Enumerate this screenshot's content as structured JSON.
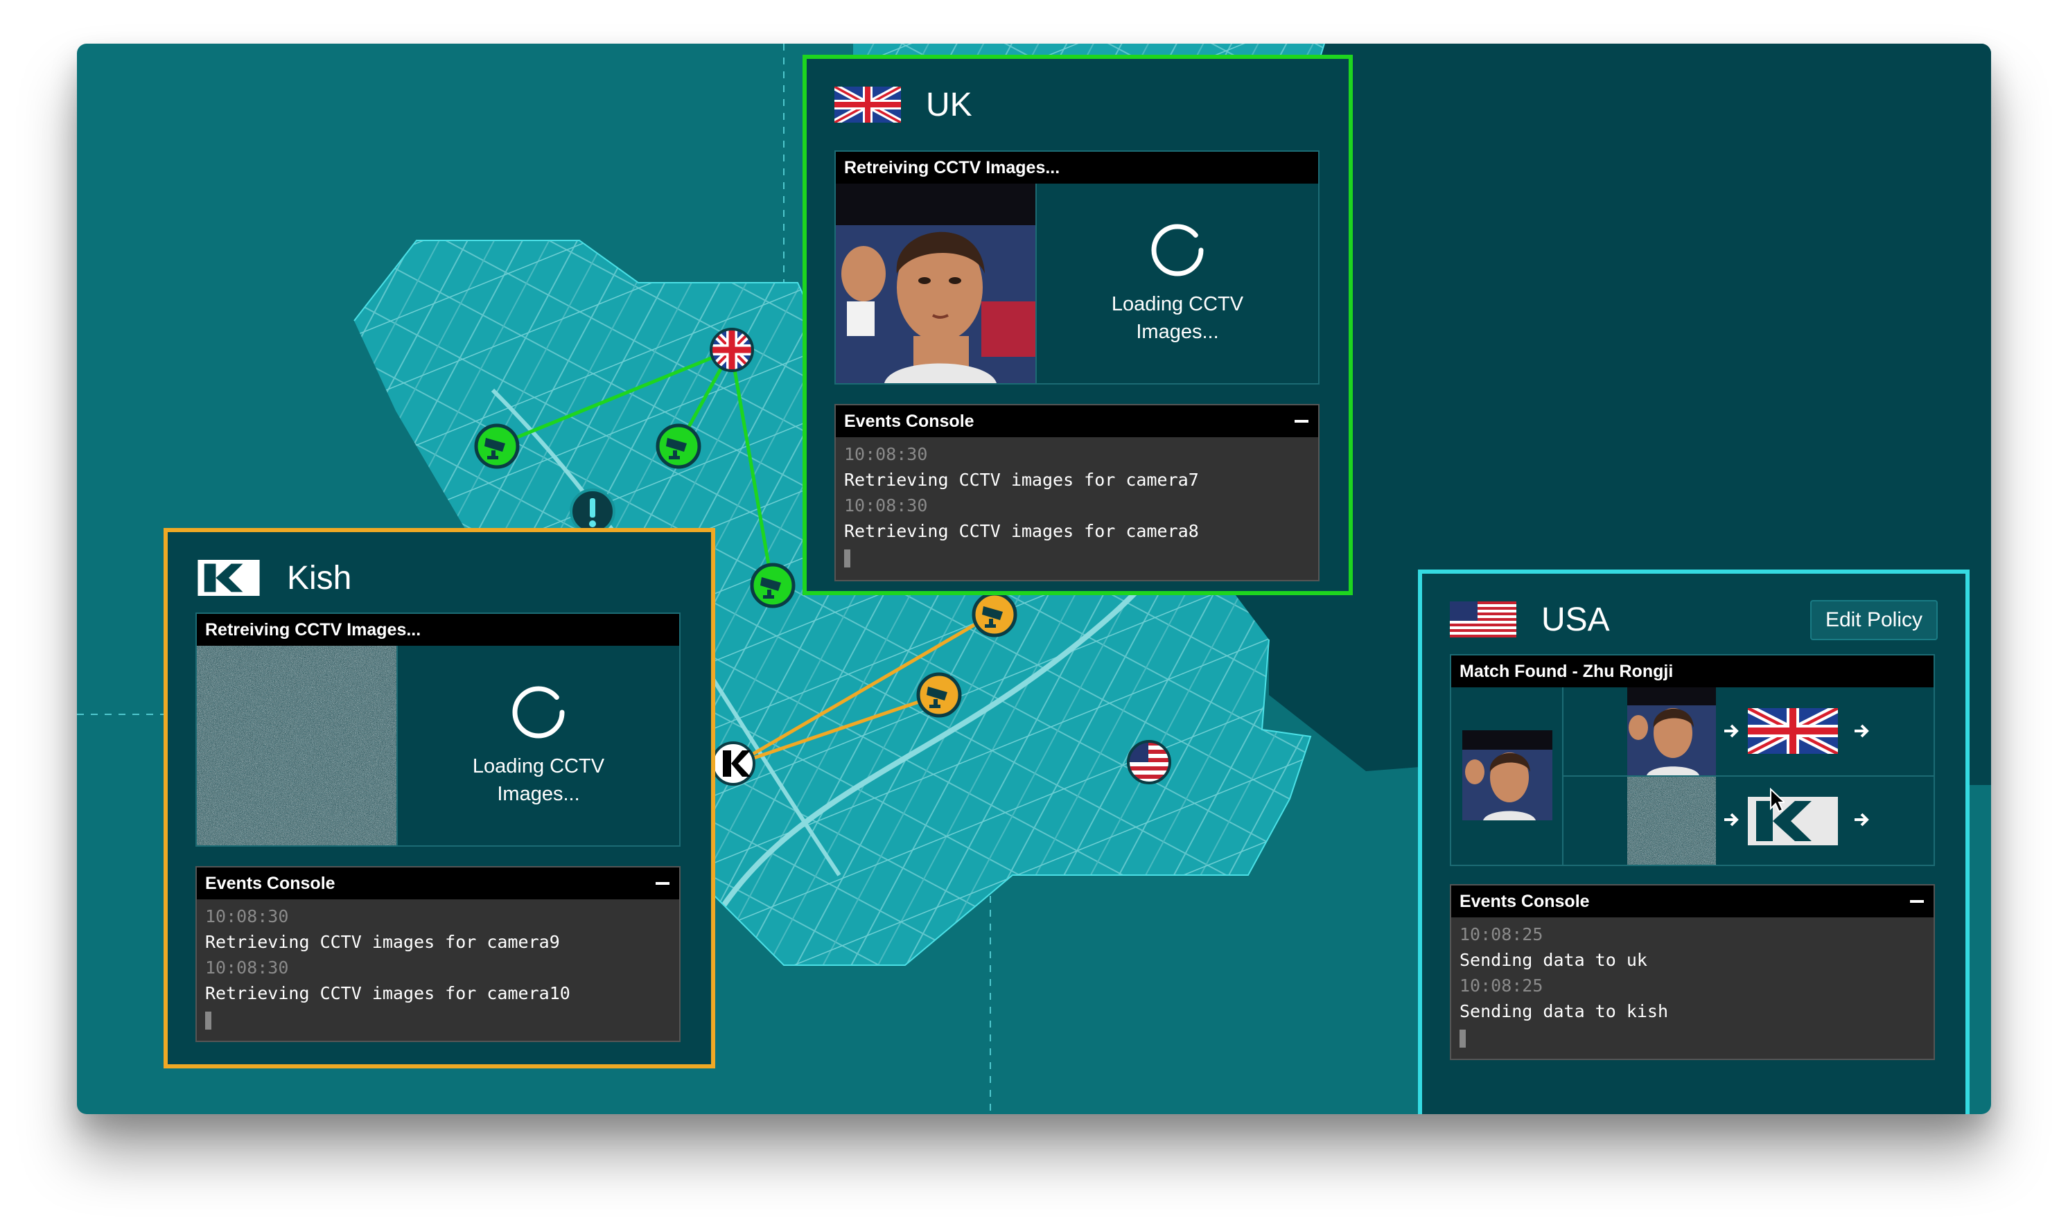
{
  "colors": {
    "background": "#0b7178",
    "map_land": "#18a4ad",
    "kish_accent": "#f0a925",
    "uk_accent": "#1ed51f",
    "usa_accent": "#35dbe2",
    "panel_bg": "#03444d",
    "console_bg": "#333333"
  },
  "map": {
    "markers": [
      {
        "name": "uk-flag-marker",
        "icon": "uk-flag-icon"
      },
      {
        "name": "usa-flag-marker",
        "icon": "us-flag-icon"
      },
      {
        "name": "kish-marker",
        "icon": "kish-logo-icon"
      },
      {
        "name": "alert-marker",
        "icon": "exclamation-icon"
      },
      {
        "name": "camera-marker",
        "icon": "cctv-camera-icon"
      }
    ]
  },
  "kish": {
    "title": "Kish",
    "icon": "kish-logo-icon",
    "image_bar": "Retreiving CCTV Images...",
    "loading_line1": "Loading CCTV",
    "loading_line2": "Images...",
    "console_title": "Events Console",
    "events": [
      {
        "time": "10:08:30",
        "message": "Retrieving CCTV images for camera9"
      },
      {
        "time": "10:08:30",
        "message": "Retrieving CCTV images for camera10"
      }
    ]
  },
  "uk": {
    "title": "UK",
    "icon": "uk-flag-icon",
    "image_bar": "Retreiving CCTV Images...",
    "loading_line1": "Loading CCTV",
    "loading_line2": "Images...",
    "console_title": "Events Console",
    "events": [
      {
        "time": "10:08:30",
        "message": "Retrieving CCTV images for camera7"
      },
      {
        "time": "10:08:30",
        "message": "Retrieving CCTV images for camera8"
      }
    ]
  },
  "usa": {
    "title": "USA",
    "icon": "us-flag-icon",
    "edit_button": "Edit Policy",
    "match_bar": "Match Found - Zhu Rongji",
    "console_title": "Events Console",
    "events": [
      {
        "time": "10:08:25",
        "message": "Sending data to uk"
      },
      {
        "time": "10:08:25",
        "message": "Sending data to kish"
      }
    ]
  }
}
